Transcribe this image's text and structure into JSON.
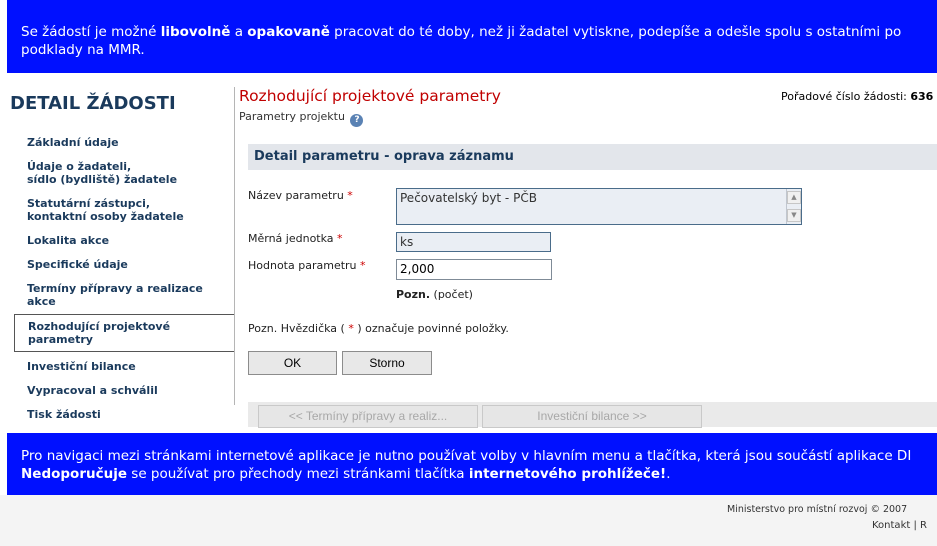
{
  "top_banner": {
    "part1": "Se žádostí je možné ",
    "bold1": "libovolně",
    "part2": " a ",
    "bold2": "opakovaně",
    "part3": " pracovat do té doby, než ji žadatel vytiskne, podepíše a odešle spolu s ostatními po",
    "line2": "podklady na MMR."
  },
  "sidebar": {
    "title": "DETAIL ŽÁDOSTI",
    "items": [
      {
        "label_line1": "Základní údaje",
        "label_line2": ""
      },
      {
        "label_line1": "Údaje o žadateli,",
        "label_line2": "sídlo (bydliště) žadatele"
      },
      {
        "label_line1": "Statutární zástupci,",
        "label_line2": "kontaktní osoby žadatele"
      },
      {
        "label_line1": "Lokalita akce",
        "label_line2": ""
      },
      {
        "label_line1": "Specifické údaje",
        "label_line2": ""
      },
      {
        "label_line1": "Termíny přípravy a realizace akce",
        "label_line2": ""
      },
      {
        "label_line1": "Rozhodující projektové parametry",
        "label_line2": "",
        "active": true
      },
      {
        "label_line1": "Investiční bilance",
        "label_line2": ""
      },
      {
        "label_line1": "Vypracoval a schválil",
        "label_line2": ""
      },
      {
        "label_line1": "Tisk žádosti",
        "label_line2": ""
      }
    ]
  },
  "main": {
    "title": "Rozhodující projektové parametry",
    "subtitle": "Parametry projektu",
    "help_icon_glyph": "?",
    "order_label": "Pořadové číslo žádosti: ",
    "order_value": "636",
    "section_header": "Detail parametru - oprava záznamu",
    "required_mark": "*",
    "fields": {
      "name_label": "Název parametru",
      "name_value": "Pečovatelský byt - PČB",
      "unit_label": "Měrná jednotka",
      "unit_value": "ks",
      "value_label": "Hodnota parametru",
      "value_value": "2,000"
    },
    "note_bold": "Pozn.",
    "note_text": " (počet)",
    "required_note_prefix": "Pozn. Hvězdička ( ",
    "required_note_suffix": " ) označuje povinné položky.",
    "buttons": {
      "ok": "OK",
      "storno": "Storno"
    },
    "pager": {
      "prev": "<<  Termíny přípravy a realiz...",
      "next": "Investiční bilance  >>"
    }
  },
  "bottom_banner": {
    "line1": "Pro navigaci mezi stránkami internetové aplikace je nutno používat volby v hlavním menu a tlačítka, která jsou součástí aplikace DI",
    "bold1": "Nedoporučuje",
    "part2": " se používat pro přechody mezi stránkami tlačítka ",
    "bold2": "internetového prohlížeče!",
    "part3": "."
  },
  "footer": {
    "copyright": "Ministerstvo pro místní rozvoj © 2007",
    "link_kontakt": "Kontakt",
    "separator": " | ",
    "link_r": "R"
  },
  "colors": {
    "banner": "#0010ff",
    "title_red": "#c00000",
    "nav_blue": "#1a3a5c"
  }
}
